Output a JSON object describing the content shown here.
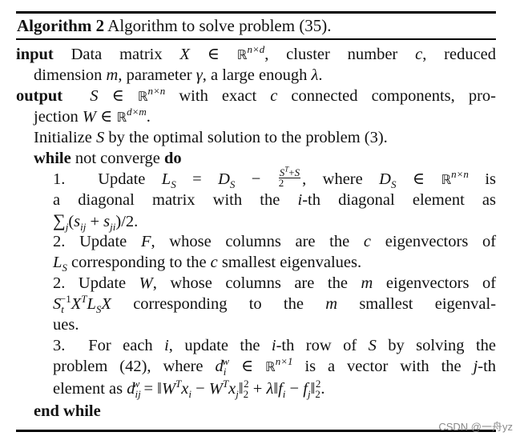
{
  "caption": {
    "label": "Algorithm 2",
    "title": "Algorithm to solve problem (35)."
  },
  "input": {
    "keyword": "input",
    "line1": "Data matrix X ∈ ℝ^{n×d}, cluster number c, reduced",
    "line2": "dimension m, parameter γ, a large enough λ."
  },
  "output": {
    "keyword": "output",
    "line1": "S ∈ ℝ^{n×n} with exact c connected components, pro-",
    "line2": "jection W ∈ ℝ^{d×m}."
  },
  "initialize": "Initialize S by the optimal solution to the problem (3).",
  "loop": {
    "while_keyword": "while",
    "condition": "not converge",
    "do_keyword": "do",
    "end_keyword": "end while"
  },
  "steps": [
    {
      "number": "1.",
      "lines": [
        "Update L_S = D_S − (S^T+S)/2, where D_S ∈ ℝ^{n×n} is",
        "a diagonal matrix with the i-th diagonal element as",
        "∑_j (s_ij + s_ji)/2."
      ]
    },
    {
      "number": "2.",
      "lines": [
        "Update F, whose columns are the c eigenvectors of",
        "L_S corresponding to the c smallest eigenvalues."
      ]
    },
    {
      "number": "2.",
      "lines": [
        "Update W, whose columns are the m eigenvectors of",
        "S_t^{-1} X^T L_S X corresponding to the m smallest eigenval-",
        "ues."
      ]
    },
    {
      "number": "3.",
      "lines": [
        "For each i, update the i-th row of S by solving the",
        "problem (42), where d_i^w ∈ ℝ^{n×1} is a vector with the j-th",
        "element as d_ij^w = ‖W^T x_i − W^T x_j‖_2^2 + λ‖f_i − f_j‖_2^2."
      ]
    }
  ],
  "text": {
    "data_matrix": "Data matrix",
    "cluster_number": ", cluster number",
    "reduced": ", reduced",
    "dimension": "dimension",
    "parameter": ", parameter",
    "large_enough": ", a large enough",
    "with_exact": "with exact",
    "connected": "connected components, pro-",
    "jection": "jection",
    "initialize_pre": "Initialize",
    "initialize_post": "by the optimal solution to the problem (3).",
    "update": "Update",
    "where": ", where",
    "is": "is",
    "diag_line": "a diagonal matrix with the",
    "diag_line2": "-th diagonal element as",
    "whose_cols": ", whose columns are the",
    "eigvecs_of": "eigenvectors of",
    "corr_to_the": "corresponding to the",
    "smallest_eigvals": "smallest eigenvalues.",
    "smallest_eigval_hy": "smallest eigenval-",
    "ues": "ues.",
    "for_each": "For each",
    "update_the": ", update the",
    "row_of": "-th row of",
    "by_solving": "by solving the",
    "problem42": "problem (42), where",
    "is_vector": "is a vector with the",
    "th": "-th",
    "element_as": "element as"
  },
  "watermark": "CSDN @一舟yz"
}
